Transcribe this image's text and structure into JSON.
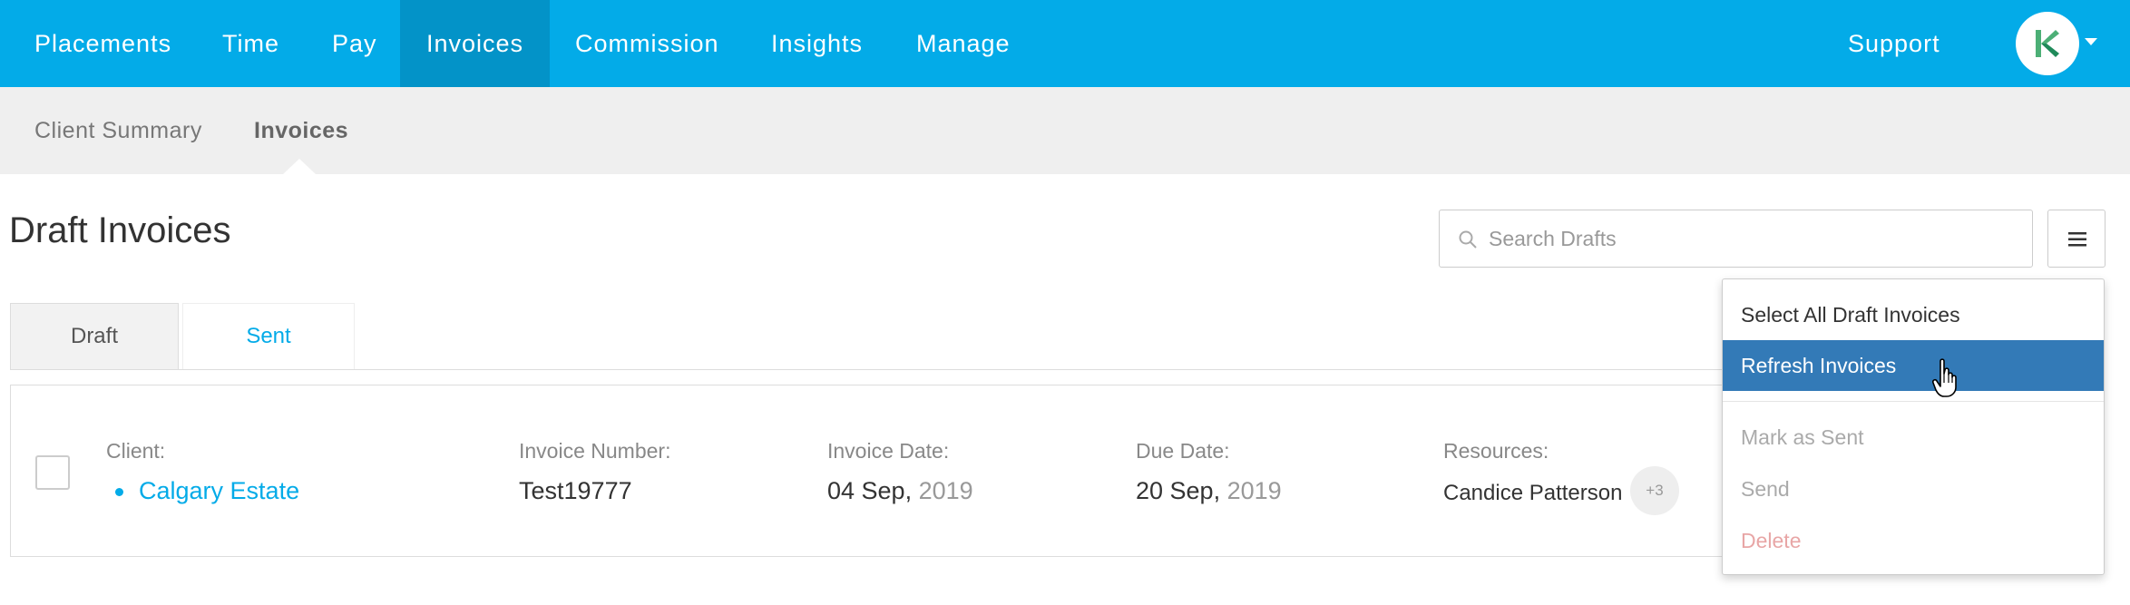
{
  "topnav": {
    "items": [
      {
        "label": "Placements"
      },
      {
        "label": "Time"
      },
      {
        "label": "Pay"
      },
      {
        "label": "Invoices",
        "active": true
      },
      {
        "label": "Commission"
      },
      {
        "label": "Insights"
      },
      {
        "label": "Manage"
      }
    ],
    "support_label": "Support",
    "avatar_icon": "k-logo-icon"
  },
  "subnav": {
    "items": [
      {
        "label": "Client Summary"
      },
      {
        "label": "Invoices",
        "active": true
      }
    ]
  },
  "page": {
    "title": "Draft Invoices"
  },
  "search": {
    "placeholder": "Search Drafts",
    "value": ""
  },
  "tabs": [
    {
      "label": "Draft",
      "active": true
    },
    {
      "label": "Sent"
    }
  ],
  "invoice": {
    "client_label": "Client:",
    "client_value": "Calgary Estate",
    "number_label": "Invoice Number:",
    "number_value": "Test19777",
    "invoice_date_label": "Invoice Date:",
    "invoice_date_day": "04 Sep,",
    "invoice_date_year": "2019",
    "due_date_label": "Due Date:",
    "due_date_day": "20 Sep,",
    "due_date_year": "2019",
    "resources_label": "Resources:",
    "resources_value": "Candice Patterson",
    "resources_more": "+3"
  },
  "dropdown": {
    "items": [
      {
        "label": "Select All Draft Invoices",
        "state": "normal"
      },
      {
        "label": "Refresh Invoices",
        "state": "active"
      },
      {
        "label": "Mark as Sent",
        "state": "disabled"
      },
      {
        "label": "Send",
        "state": "disabled"
      },
      {
        "label": "Delete",
        "state": "disabled-danger"
      }
    ]
  },
  "colors": {
    "brand": "#03abe8",
    "nav_active": "#0393c8",
    "menu_active": "#337ab7",
    "subnav_bg": "#efefef"
  }
}
